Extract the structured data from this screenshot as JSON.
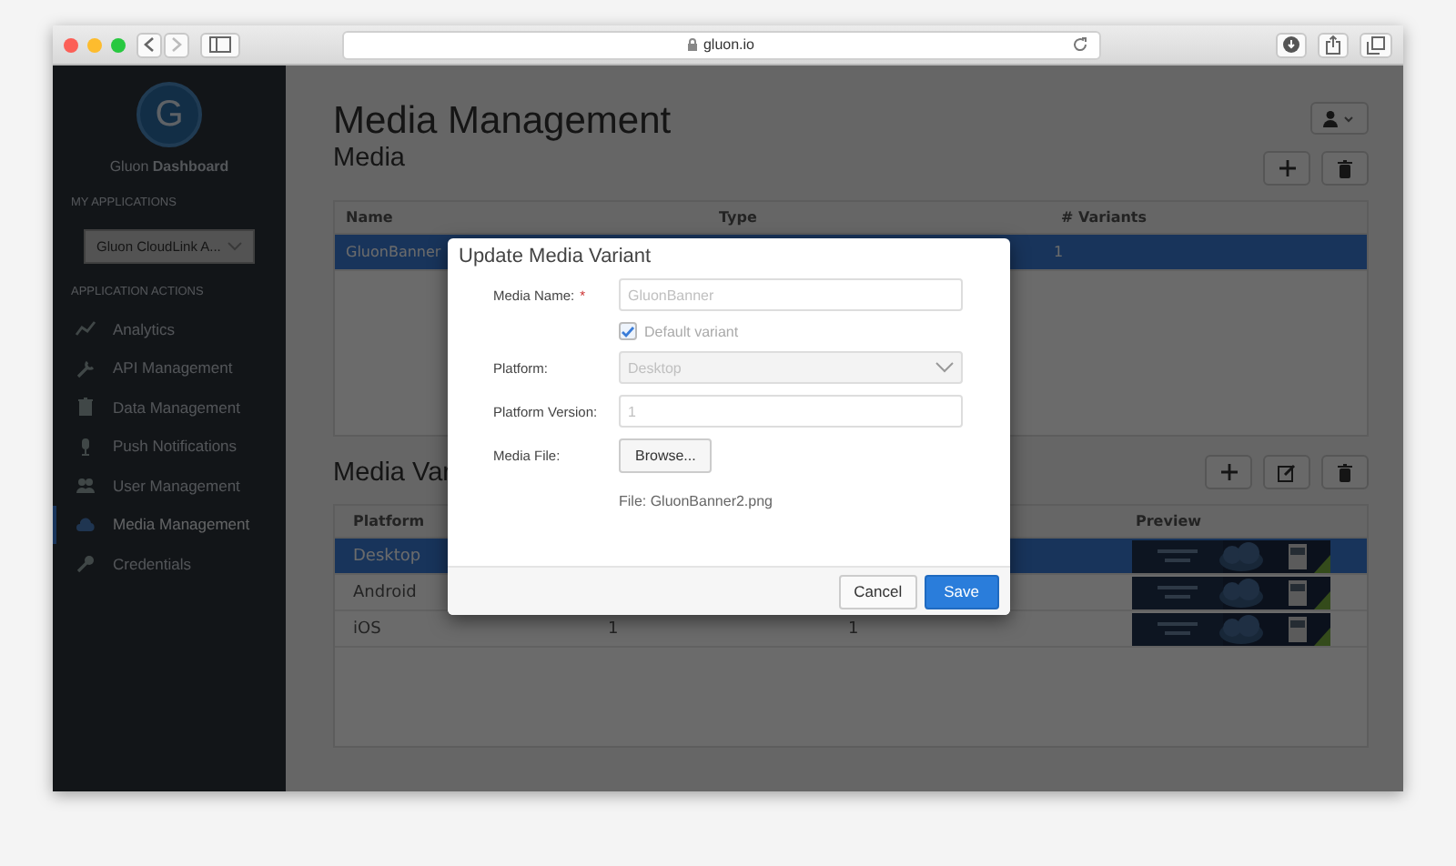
{
  "browser": {
    "address": "gluon.io"
  },
  "sidebar": {
    "logo_letter": "G",
    "brand": "Gluon **Dashboard**",
    "apps_heading": "MY APPLICATIONS",
    "app_select": "Gluon CloudLink A...",
    "actions_heading": "APPLICATION ACTIONS",
    "items": [
      {
        "label": "Analytics",
        "selected": false
      },
      {
        "label": "API Management",
        "selected": false
      },
      {
        "label": "Data Management",
        "selected": false
      },
      {
        "label": "Push Notifications",
        "selected": false
      },
      {
        "label": "User Management",
        "selected": false
      },
      {
        "label": "Media Management",
        "selected": true
      },
      {
        "label": "Credentials",
        "selected": false
      }
    ]
  },
  "page": {
    "title": "Media Management",
    "media": {
      "heading": "Media",
      "columns": [
        "Name",
        "Type",
        "# Variants"
      ],
      "rows": [
        {
          "name": "GluonBanner",
          "variants": "1",
          "selected": true
        }
      ]
    },
    "variants": {
      "heading": "Media Var",
      "columns": [
        {
          "label": "Platform"
        },
        {
          "label": "Preview"
        }
      ],
      "rows": [
        {
          "platform": "Desktop",
          "selected": true
        },
        {
          "platform": "Android",
          "selected": false
        },
        {
          "platform": "iOS",
          "column_2": "1",
          "column_3": "1",
          "selected": false
        }
      ]
    }
  },
  "modal": {
    "title": "Update Media Variant",
    "fields": [
      {
        "kind": "text",
        "label": "Media Name:",
        "required_mark": "*",
        "placeholder": "GluonBanner"
      },
      {
        "kind": "checkbox",
        "label": "Default variant",
        "checked": true
      },
      {
        "kind": "select",
        "label": "Platform:",
        "value": "Desktop",
        "disabled": true
      },
      {
        "kind": "text",
        "label": "Platform Version:",
        "placeholder": "1"
      },
      {
        "kind": "file",
        "label": "Media File:",
        "button": "Browse...",
        "file": "File: GluonBanner2.png"
      }
    ],
    "buttons": [
      {
        "label": "Cancel",
        "primary": false
      },
      {
        "label": "Save",
        "primary": true
      }
    ]
  }
}
